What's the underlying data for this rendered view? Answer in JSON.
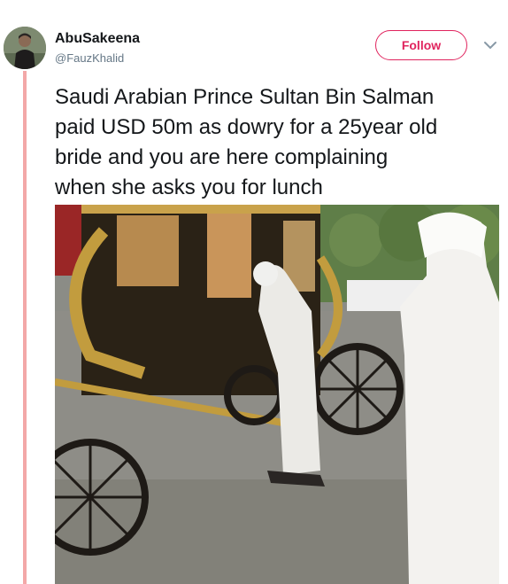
{
  "tweet": {
    "author_name": "AbuSakeena",
    "author_handle": "@FauzKhalid",
    "follow_label": "Follow",
    "text": "Saudi Arabian Prince Sultan Bin Salman\npaid USD 50m as dowry for a 25year old\nbride and you are here complaining\nwhen she asks you for lunch"
  },
  "icons": {
    "avatar": "avatar-image",
    "more": "chevron-down-icon"
  },
  "colors": {
    "accent": "#e0245e",
    "thread_line": "#f3a8a8",
    "text": "#14171a",
    "muted": "#657786"
  },
  "media": {
    "type": "video-frame",
    "description_icon": "media-image"
  }
}
